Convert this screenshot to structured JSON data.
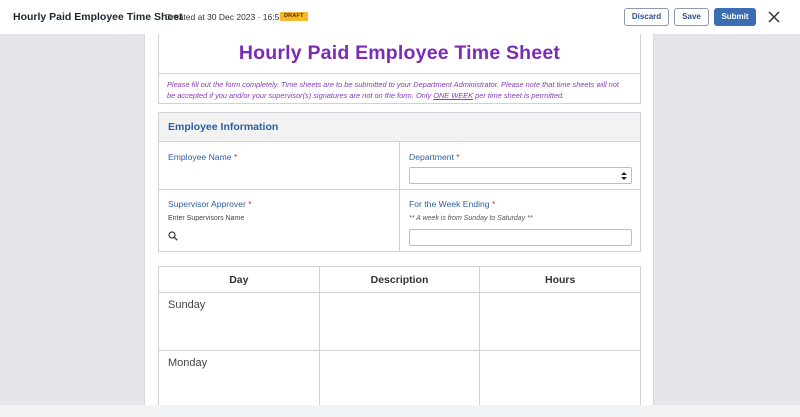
{
  "header": {
    "title": "Hourly Paid Employee Time Sheet",
    "created": "Created at 30 Dec 2023 · 16:58",
    "status_badge": "DRAFT",
    "discard_label": "Discard",
    "save_label": "Save",
    "submit_label": "Submit"
  },
  "form": {
    "title": "Hourly Paid Employee Time Sheet",
    "instructions_1": "Please fill out the form completely. Time sheets are to be submitted to your Department Administrator. Please note that time sheets will not be accepted if you and/or your supervisor(s) signatures are not on the form. Only ",
    "instructions_link": "ONE WEEK",
    "instructions_2": " per time sheet is permitted."
  },
  "employee_info": {
    "heading": "Employee Information",
    "employee_name_label": "Employee Name",
    "department_label": "Department",
    "department_value": "",
    "supervisor_label": "Supervisor Approver",
    "supervisor_hint": "Enter Supervisors Name",
    "week_ending_label": "For the Week Ending",
    "week_ending_hint": "** A week is from Sunday to Saturday **",
    "week_ending_value": "",
    "required_mark": "*"
  },
  "timesheet": {
    "headers": [
      "Day",
      "Description",
      "Hours"
    ],
    "rows": [
      "Sunday",
      "Monday"
    ]
  },
  "colors": {
    "title_purple": "#7b2bb5",
    "label_blue": "#2d5fa0",
    "primary_button": "#3a6db1",
    "badge_yellow": "#f5b82e"
  }
}
